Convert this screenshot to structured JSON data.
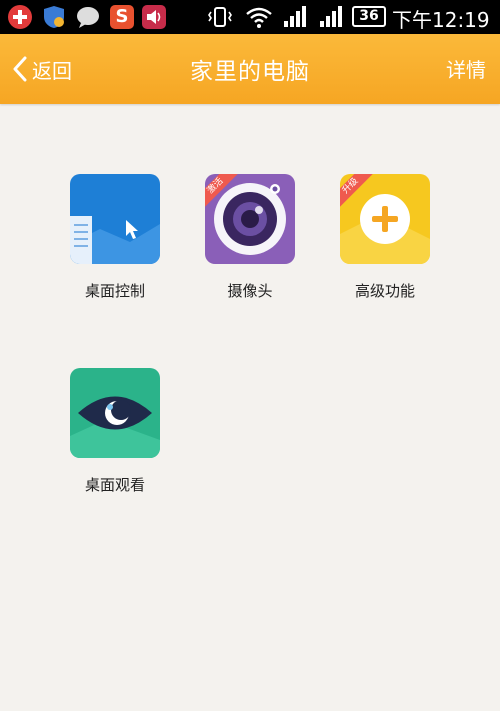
{
  "status_bar": {
    "battery": "36",
    "time": "下午12:19",
    "icons": [
      "red-plus-icon",
      "shield-icon",
      "chat-bubble-icon",
      "s-app-icon",
      "speaker-icon",
      "vibrate-icon",
      "wifi-icon",
      "signal-icon",
      "signal-icon-2"
    ]
  },
  "header": {
    "back_label": "返回",
    "title": "家里的电脑",
    "details_label": "详情"
  },
  "tiles": [
    {
      "label": "桌面控制",
      "icon": "desktop-control-icon",
      "color": "#1e7fd6"
    },
    {
      "label": "摄像头",
      "icon": "camera-icon",
      "color": "#8a5fb8",
      "badge": "激活"
    },
    {
      "label": "高级功能",
      "icon": "advanced-plus-icon",
      "color": "#f6c81f",
      "badge": "升级"
    },
    {
      "label": "桌面观看",
      "icon": "eye-icon",
      "color": "#2bb38a"
    }
  ],
  "colors": {
    "header": "#f6a623",
    "background": "#f4f2ee"
  }
}
